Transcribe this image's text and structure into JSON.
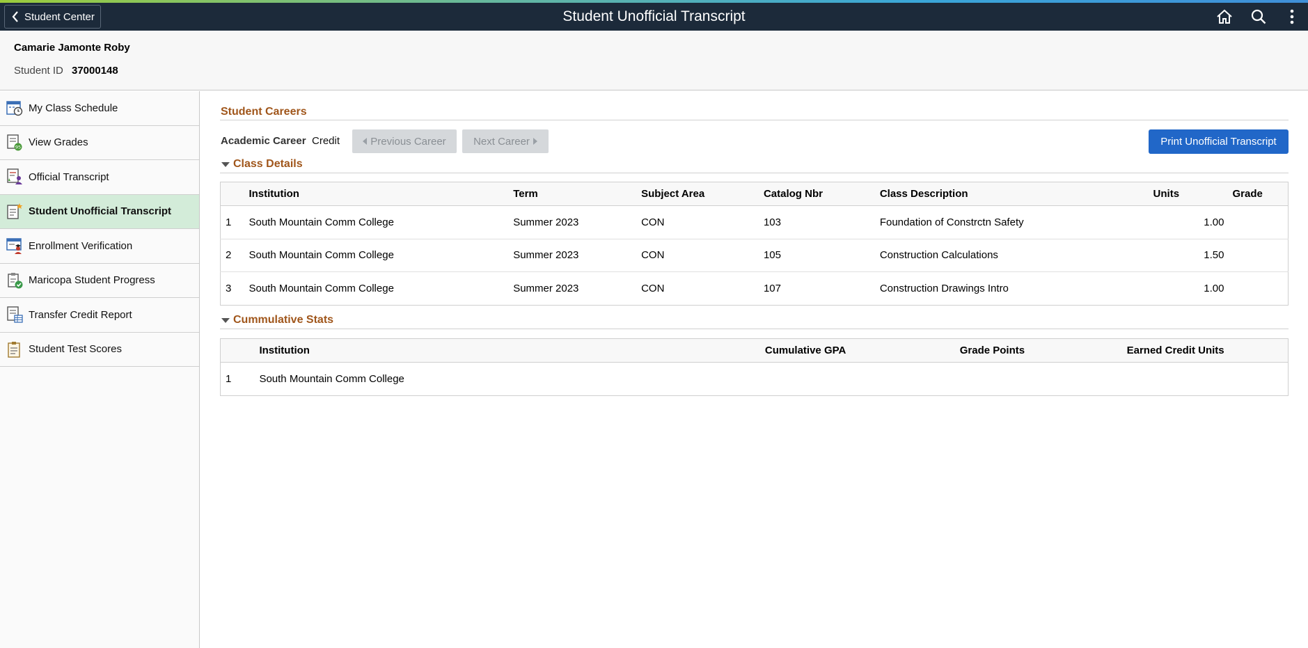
{
  "header": {
    "back_label": "Student Center",
    "title": "Student Unofficial Transcript",
    "icons": [
      "home-icon",
      "search-icon",
      "actions-menu-icon"
    ]
  },
  "student": {
    "name": "Camarie Jamonte Roby",
    "id_label": "Student ID",
    "id_value": "37000148"
  },
  "sidebar": {
    "items": [
      {
        "label": "My Class Schedule",
        "icon": "calendar-clock-icon"
      },
      {
        "label": "View Grades",
        "icon": "grades-report-icon"
      },
      {
        "label": "Official Transcript",
        "icon": "official-transcript-icon"
      },
      {
        "label": "Student Unofficial Transcript",
        "icon": "unofficial-transcript-icon",
        "active": true
      },
      {
        "label": "Enrollment Verification",
        "icon": "enrollment-verification-icon"
      },
      {
        "label": "Maricopa Student Progress",
        "icon": "student-progress-icon"
      },
      {
        "label": "Transfer Credit Report",
        "icon": "transfer-credit-icon"
      },
      {
        "label": "Student Test Scores",
        "icon": "test-scores-icon"
      }
    ]
  },
  "careers": {
    "section_title": "Student Careers",
    "career_label": "Academic Career",
    "career_value": "Credit",
    "prev_label": "Previous Career",
    "next_label": "Next Career",
    "print_label": "Print Unofficial Transcript"
  },
  "class_details": {
    "section_title": "Class Details",
    "columns": [
      "Institution",
      "Term",
      "Subject Area",
      "Catalog Nbr",
      "Class Description",
      "Units",
      "Grade"
    ],
    "rows": [
      {
        "n": "1",
        "institution": "South Mountain Comm College",
        "term": "Summer 2023",
        "subject": "CON",
        "catalog": "103",
        "description": "Foundation of Constrctn Safety",
        "units": "1.00",
        "grade": ""
      },
      {
        "n": "2",
        "institution": "South Mountain Comm College",
        "term": "Summer 2023",
        "subject": "CON",
        "catalog": "105",
        "description": "Construction Calculations",
        "units": "1.50",
        "grade": ""
      },
      {
        "n": "3",
        "institution": "South Mountain Comm College",
        "term": "Summer 2023",
        "subject": "CON",
        "catalog": "107",
        "description": "Construction Drawings Intro",
        "units": "1.00",
        "grade": ""
      }
    ]
  },
  "cumulative": {
    "section_title": "Cummulative Stats",
    "columns": [
      "Institution",
      "Cumulative GPA",
      "Grade Points",
      "Earned Credit Units"
    ],
    "rows": [
      {
        "n": "1",
        "institution": "South Mountain Comm College",
        "gpa": "",
        "grade_points": "",
        "credit_units": ""
      }
    ]
  },
  "colors": {
    "header_bg": "#1c2a3a",
    "section_title": "#a0561b",
    "primary_button": "#2167c8",
    "active_nav": "#d3ecd9"
  }
}
